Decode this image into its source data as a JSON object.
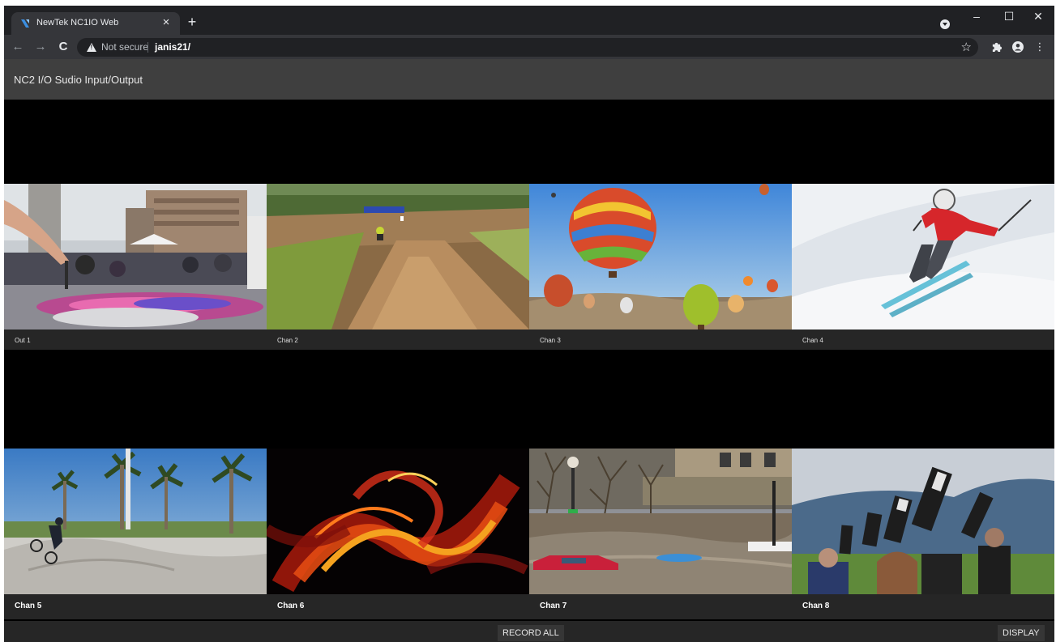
{
  "browser": {
    "tab_title": "NewTek NC1IO Web",
    "tab_close_icon": "×",
    "new_tab_icon": "+",
    "security_label": "Not secure",
    "url": "janis21/",
    "window_controls": [
      "–",
      "☐",
      "✕"
    ]
  },
  "app": {
    "title": "NC2 I/O Sudio Input/Output"
  },
  "channels": [
    {
      "label": "Out 1",
      "image": "street-art-painting"
    },
    {
      "label": "Chan 2",
      "image": "motocross-dirt-track"
    },
    {
      "label": "Chan 3",
      "image": "hot-air-balloons"
    },
    {
      "label": "Chan 4",
      "image": "skier-in-red"
    },
    {
      "label": "Chan 5",
      "image": "skatepark-bmx-palms"
    },
    {
      "label": "Chan 6",
      "image": "abstract-fire-swirls"
    },
    {
      "label": "Chan 7",
      "image": "flooded-street-cars"
    },
    {
      "label": "Chan 8",
      "image": "photographers-telephoto-lenses"
    }
  ],
  "actions": {
    "record_all": "RECORD ALL",
    "display": "DISPLAY"
  },
  "colors": {
    "app_header": "#3f3f3f",
    "tile_label_bg": "#262626",
    "chrome_dark": "#202124",
    "chrome_toolbar": "#35363a"
  }
}
